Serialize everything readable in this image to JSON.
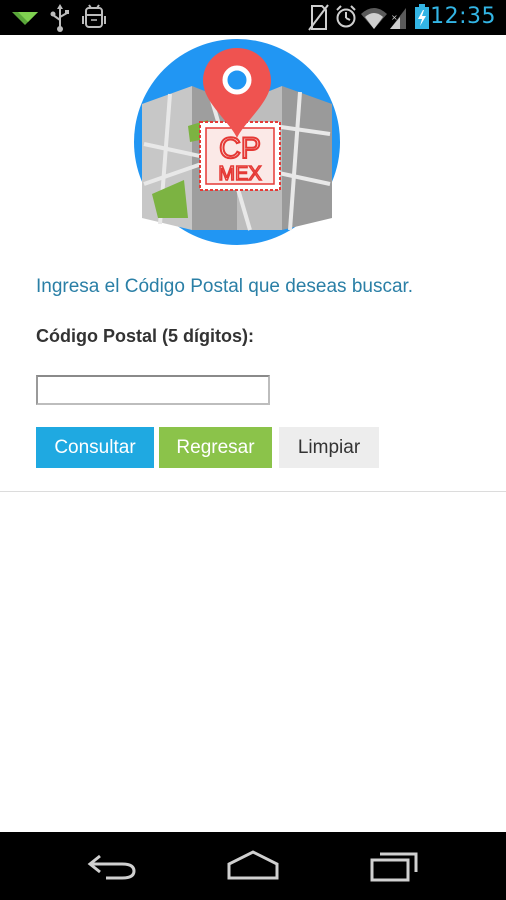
{
  "status_bar": {
    "time": "12:35",
    "icons": [
      "signal-notification-icon",
      "usb-icon",
      "android-debug-icon",
      "no-sim-icon",
      "alarm-icon",
      "wifi-icon",
      "cell-signal-icon",
      "battery-charging-icon"
    ]
  },
  "logo": {
    "line1": "CP",
    "line2": "MEX",
    "colors": {
      "circle": "#2196f3",
      "pin": "#ef5350",
      "map": "#b0b0b0",
      "park": "#7cb342"
    }
  },
  "form": {
    "prompt": "Ingresa el Código Postal que deseas buscar.",
    "label": "Código Postal (5 dígitos):",
    "input_value": "",
    "buttons": {
      "consultar": "Consultar",
      "regresar": "Regresar",
      "limpiar": "Limpiar"
    }
  },
  "nav_bar": {
    "icons": [
      "back-icon",
      "home-icon",
      "recents-icon"
    ]
  },
  "colors": {
    "accent": "#33b5e5",
    "consultar": "#1fa9e1",
    "regresar": "#8bc34a",
    "limpiar": "#ededed",
    "prompt_text": "#2a7fa6"
  }
}
